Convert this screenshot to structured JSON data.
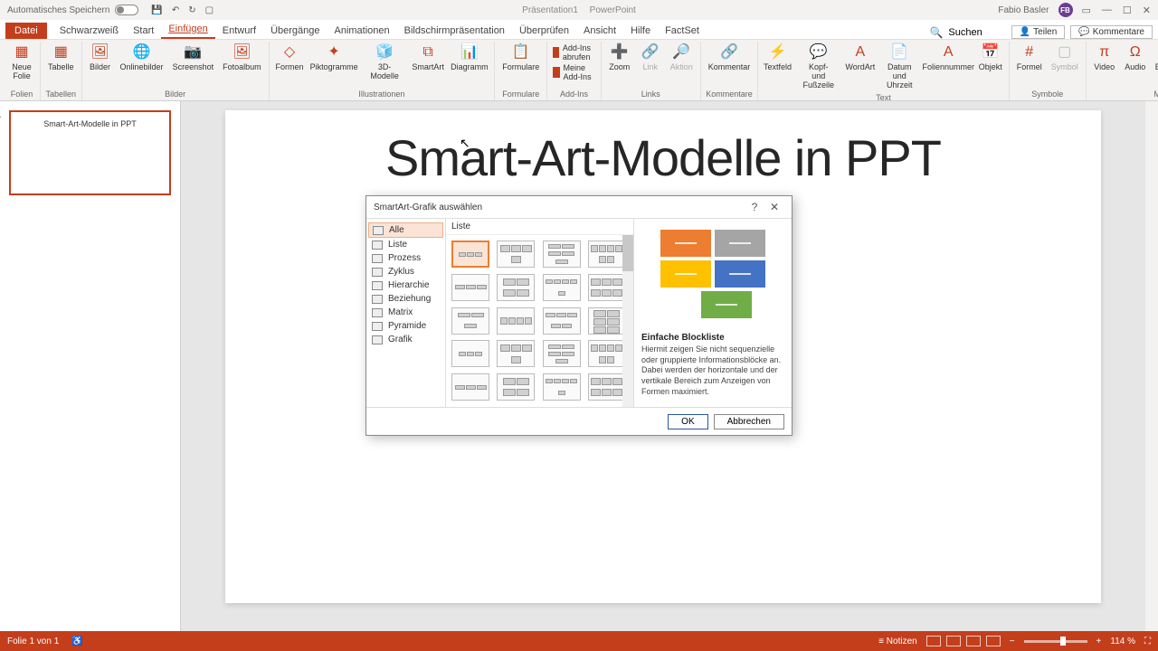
{
  "titlebar": {
    "autosave": "Automatisches Speichern",
    "doc": "Präsentation1",
    "app": "PowerPoint",
    "user": "Fabio Basler",
    "user_initials": "FB"
  },
  "tabs": {
    "file": "Datei",
    "items": [
      "Schwarzweiß",
      "Start",
      "Einfügen",
      "Entwurf",
      "Übergänge",
      "Animationen",
      "Bildschirmpräsentation",
      "Überprüfen",
      "Ansicht",
      "Hilfe",
      "FactSet"
    ],
    "active_index": 2,
    "search": "Suchen",
    "share": "Teilen",
    "comments": "Kommentare"
  },
  "ribbon": {
    "groups": [
      {
        "label": "Folien",
        "items": [
          {
            "t": "Neue Folie"
          }
        ]
      },
      {
        "label": "Tabellen",
        "items": [
          {
            "t": "Tabelle"
          }
        ]
      },
      {
        "label": "Bilder",
        "items": [
          {
            "t": "Bilder"
          },
          {
            "t": "Onlinebilder"
          },
          {
            "t": "Screenshot"
          },
          {
            "t": "Fotoalbum"
          }
        ]
      },
      {
        "label": "Illustrationen",
        "items": [
          {
            "t": "Formen"
          },
          {
            "t": "Piktogramme"
          },
          {
            "t": "3D-Modelle"
          },
          {
            "t": "SmartArt"
          },
          {
            "t": "Diagramm"
          }
        ]
      },
      {
        "label": "Formulare",
        "items": [
          {
            "t": "Formulare"
          }
        ]
      },
      {
        "label": "Add-Ins",
        "split": [
          {
            "t": "Add-Ins abrufen"
          },
          {
            "t": "Meine Add-Ins"
          }
        ]
      },
      {
        "label": "Links",
        "items": [
          {
            "t": "Zoom"
          },
          {
            "t": "Link",
            "d": true
          },
          {
            "t": "Aktion",
            "d": true
          }
        ]
      },
      {
        "label": "Kommentare",
        "items": [
          {
            "t": "Kommentar"
          }
        ]
      },
      {
        "label": "Text",
        "items": [
          {
            "t": "Textfeld"
          },
          {
            "t": "Kopf- und Fußzeile"
          },
          {
            "t": "WordArt"
          },
          {
            "t": "Datum und Uhrzeit"
          },
          {
            "t": "Foliennummer"
          },
          {
            "t": "Objekt"
          }
        ]
      },
      {
        "label": "Symbole",
        "items": [
          {
            "t": "Formel"
          },
          {
            "t": "Symbol",
            "d": true
          }
        ]
      },
      {
        "label": "Medien",
        "items": [
          {
            "t": "Video"
          },
          {
            "t": "Audio"
          },
          {
            "t": "Bildschirmaufzeichnung"
          }
        ]
      }
    ]
  },
  "slide": {
    "number": "1",
    "title": "Smart-Art-Modelle in PPT",
    "thumb_title": "Smart-Art-Modelle in PPT"
  },
  "dialog": {
    "title": "SmartArt-Grafik auswählen",
    "categories": [
      "Alle",
      "Liste",
      "Prozess",
      "Zyklus",
      "Hierarchie",
      "Beziehung",
      "Matrix",
      "Pyramide",
      "Grafik"
    ],
    "selected_cat": 0,
    "grid_header": "Liste",
    "preview": {
      "name": "Einfache Blockliste",
      "desc": "Hiermit zeigen Sie nicht sequenzielle oder gruppierte Informationsblöcke an. Dabei werden der horizontale und der vertikale Bereich zum Anzeigen von Formen maximiert.",
      "colors": [
        "#ed7d31",
        "#a5a5a5",
        "#ffc000",
        "#4472c4",
        "#70ad47"
      ]
    },
    "ok": "OK",
    "cancel": "Abbrechen"
  },
  "statusbar": {
    "slide": "Folie 1 von 1",
    "notes": "Notizen",
    "zoom": "114 %"
  }
}
